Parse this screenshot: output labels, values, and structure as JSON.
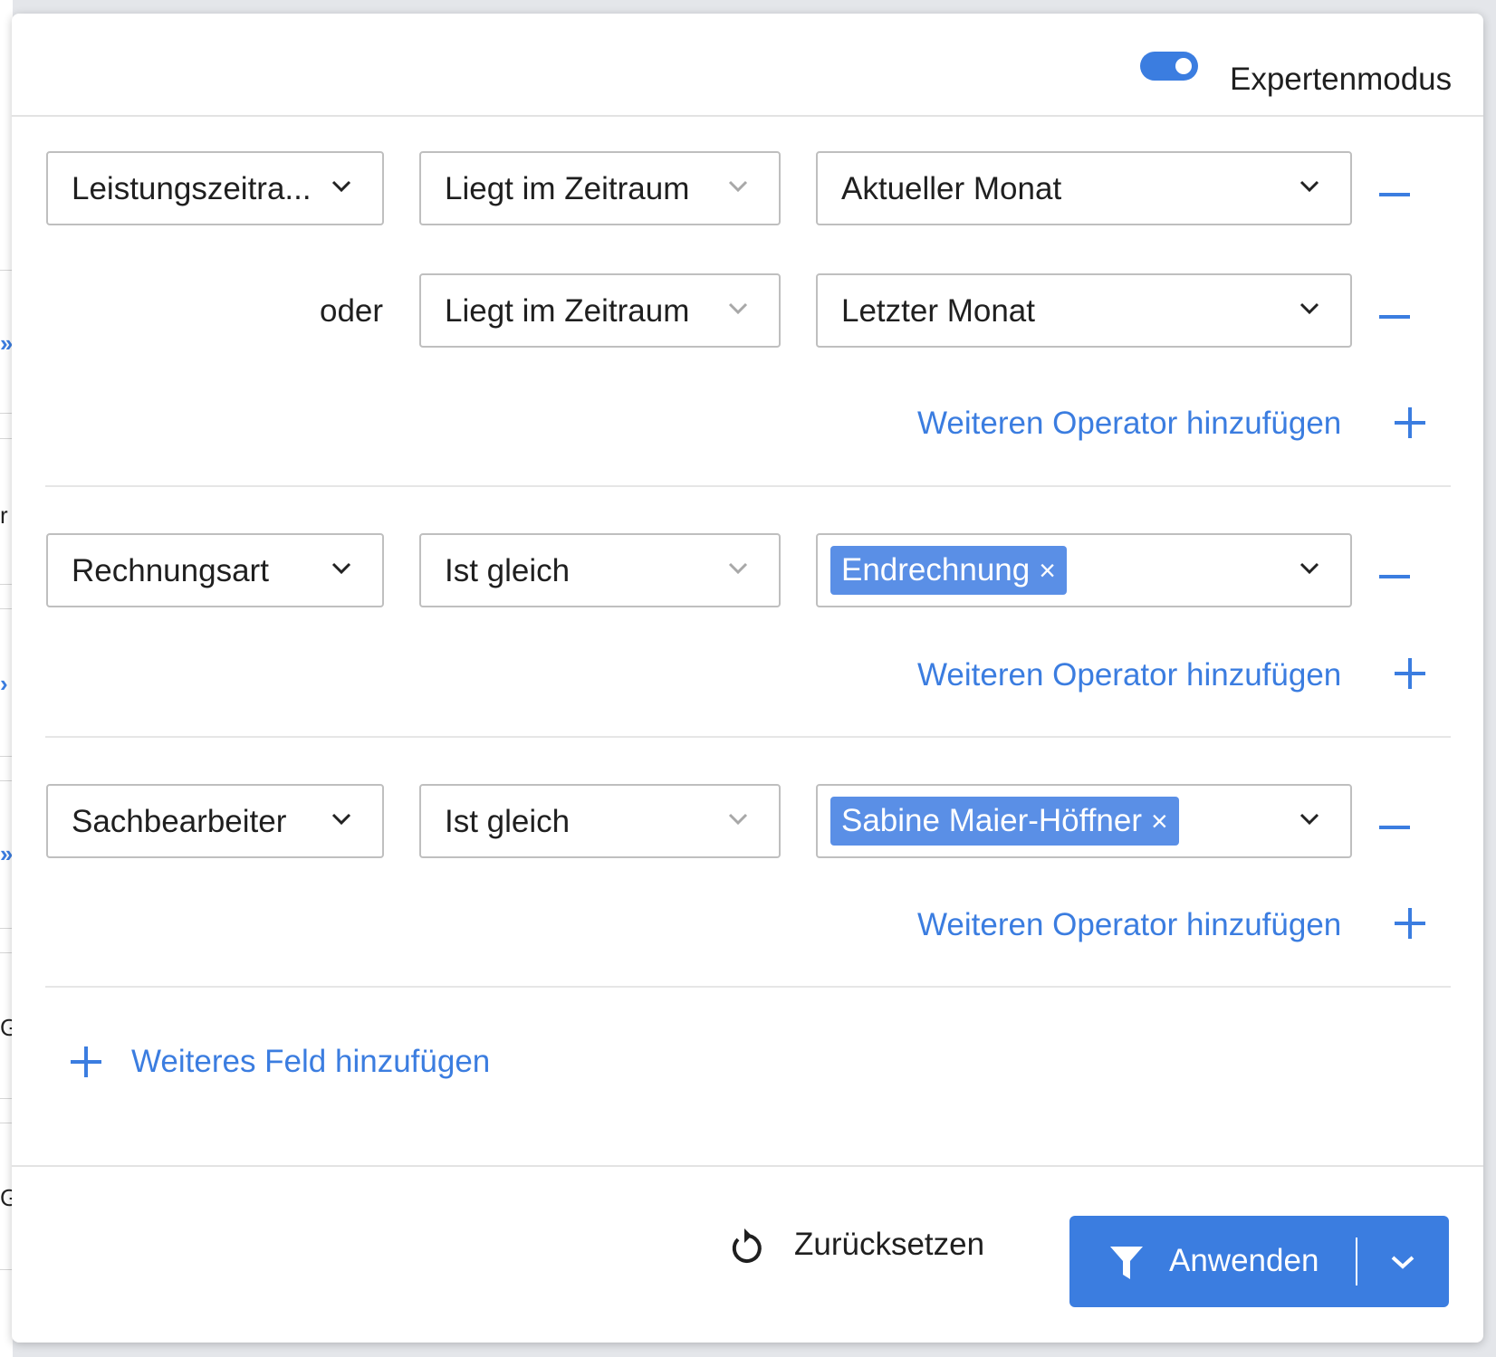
{
  "header": {
    "expert_mode_label": "Expertenmodus",
    "expert_mode_enabled": true
  },
  "filters": [
    {
      "field": "Leistungszeitra...",
      "rows": [
        {
          "connector": "",
          "operator": "Liegt im Zeitraum",
          "value": "Aktueller Monat"
        },
        {
          "connector": "oder",
          "operator": "Liegt im Zeitraum",
          "value": "Letzter Monat"
        }
      ],
      "add_operator_label": "Weiteren Operator hinzufügen"
    },
    {
      "field": "Rechnungsart",
      "rows": [
        {
          "operator": "Ist gleich",
          "chip": "Endrechnung"
        }
      ],
      "add_operator_label": "Weiteren Operator hinzufügen"
    },
    {
      "field": "Sachbearbeiter",
      "rows": [
        {
          "operator": "Ist gleich",
          "chip": "Sabine Maier-Höffner"
        }
      ],
      "add_operator_label": "Weiteren Operator hinzufügen"
    }
  ],
  "add_field_label": "Weiteres Feld hinzufügen",
  "footer": {
    "reset_label": "Zurücksetzen",
    "apply_label": "Anwenden"
  },
  "icons": {
    "chip_remove": "×",
    "toggle": "toggle-switch-icon",
    "chevron": "chevron-down-icon",
    "minus": "minus-icon",
    "plus": "plus-icon",
    "reset": "reset-icon",
    "filter": "filter-funnel-icon"
  },
  "colors": {
    "accent": "#3b7de0",
    "chip": "#5a8fe6"
  },
  "background": {
    "edge_glyphs": [
      "»",
      "r",
      "›",
      "»",
      "G",
      "G"
    ]
  }
}
